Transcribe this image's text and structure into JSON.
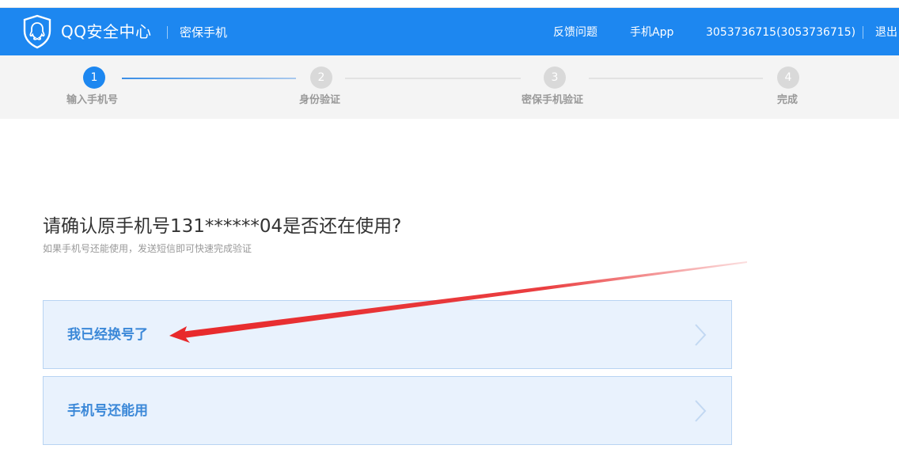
{
  "header": {
    "brand": "QQ安全中心",
    "subtitle": "密保手机",
    "nav": {
      "feedback": "反馈问题",
      "app": "手机App",
      "account": "3053736715(3053736715)",
      "logout": "退出"
    }
  },
  "steps": [
    {
      "number": "1",
      "label": "输入手机号",
      "active": true
    },
    {
      "number": "2",
      "label": "身份验证",
      "active": false
    },
    {
      "number": "3",
      "label": "密保手机验证",
      "active": false
    },
    {
      "number": "4",
      "label": "完成",
      "active": false
    }
  ],
  "main": {
    "question": "请确认原手机号131******04是否还在使用?",
    "hint": "如果手机号还能使用，发送短信即可快速完成验证",
    "options": [
      {
        "label": "我已经换号了"
      },
      {
        "label": "手机号还能用"
      }
    ]
  },
  "colors": {
    "header": "#1d87f0",
    "step_active": "#1d87f0",
    "step_inactive": "#d9d9d9",
    "option_bg": "#e9f2fd",
    "option_text": "#3b88d8",
    "annotation_arrow": "#e8292b"
  },
  "icons": {
    "logo": "qq-shield-logo-icon",
    "option_arrow": "chevron-right-icon",
    "annotation": "red-arrow-annotation"
  }
}
